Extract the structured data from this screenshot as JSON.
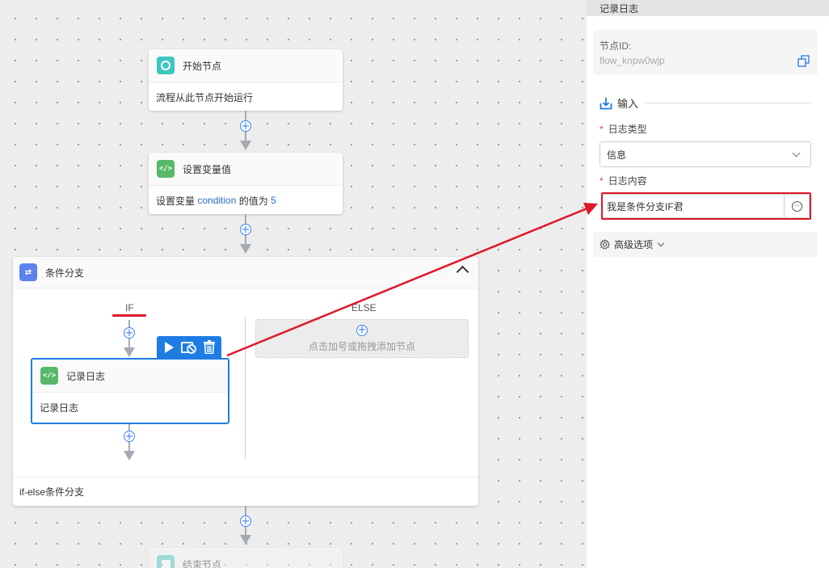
{
  "canvas": {
    "start_node": {
      "title": "开始节点",
      "body": "流程从此节点开始运行"
    },
    "set_var_node": {
      "title": "设置变量值",
      "body_prefix": "设置变量 ",
      "var_name": "condition",
      "body_mid": " 的值为 ",
      "value": "5"
    },
    "branch": {
      "title": "条件分支",
      "if_label": "IF",
      "else_label": "ELSE",
      "add_hint": "点击加号或拖拽添加节点",
      "footer": "if-else条件分支",
      "log_node": {
        "title": "记录日志",
        "body": "记录日志"
      }
    },
    "end_node": {
      "title": "结束节点"
    }
  },
  "panel": {
    "header": "记录日志",
    "node_id_label": "节点ID:",
    "node_id_value": "flow_knpw0wjp",
    "section_input": "输入",
    "log_type_label": "日志类型",
    "log_type_value": "信息",
    "log_content_label": "日志内容",
    "log_content_value": "我是条件分支IF君",
    "advanced_label": "高级选项"
  },
  "colors": {
    "accent": "#1e7de3",
    "annotation_red": "#e0182a",
    "start_icon": "#3ec7c0",
    "code_icon": "#58b86a",
    "branch_icon": "#5b82f0"
  },
  "icons": [
    "circle-start-icon",
    "code-icon",
    "branch-icon",
    "play-icon",
    "disable-icon",
    "trash-icon",
    "copy-icon",
    "import-icon",
    "gear-icon",
    "more-icon"
  ]
}
